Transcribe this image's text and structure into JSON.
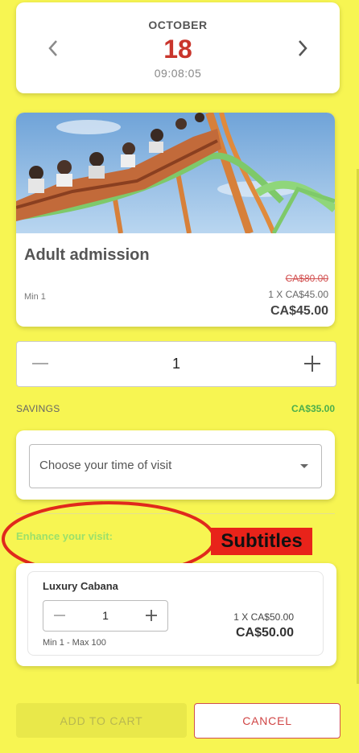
{
  "date_picker": {
    "month": "OCTOBER",
    "day": "18",
    "time": "09:08:05"
  },
  "ticket": {
    "title": "Adult admission",
    "min_label": "Min 1",
    "original_price": "CA$80.00",
    "unit_price": "1 X CA$45.00",
    "total_price": "CA$45.00"
  },
  "quantity": {
    "value": "1"
  },
  "savings": {
    "label": "SAVINGS",
    "amount": "CA$35.00"
  },
  "time_select": {
    "placeholder": "Choose your time of visit"
  },
  "enhance": {
    "heading": "Enhance your visit:",
    "annotation": "Subtitles"
  },
  "cabana": {
    "title": "Luxury Cabana",
    "quantity": "1",
    "limits": "Min 1 - Max 100",
    "unit_price": "1 X CA$50.00",
    "total_price": "CA$50.00"
  },
  "actions": {
    "add_to_cart": "ADD TO CART",
    "cancel": "CANCEL"
  },
  "colors": {
    "background": "#f7f552",
    "accent_red": "#c9352c",
    "savings_green": "#4cae4c",
    "enhance_green": "#9be06a",
    "annotation_red": "#e8231a"
  },
  "icons": [
    "chevron-left-icon",
    "chevron-right-icon",
    "minus-icon",
    "plus-icon",
    "caret-down-icon"
  ]
}
